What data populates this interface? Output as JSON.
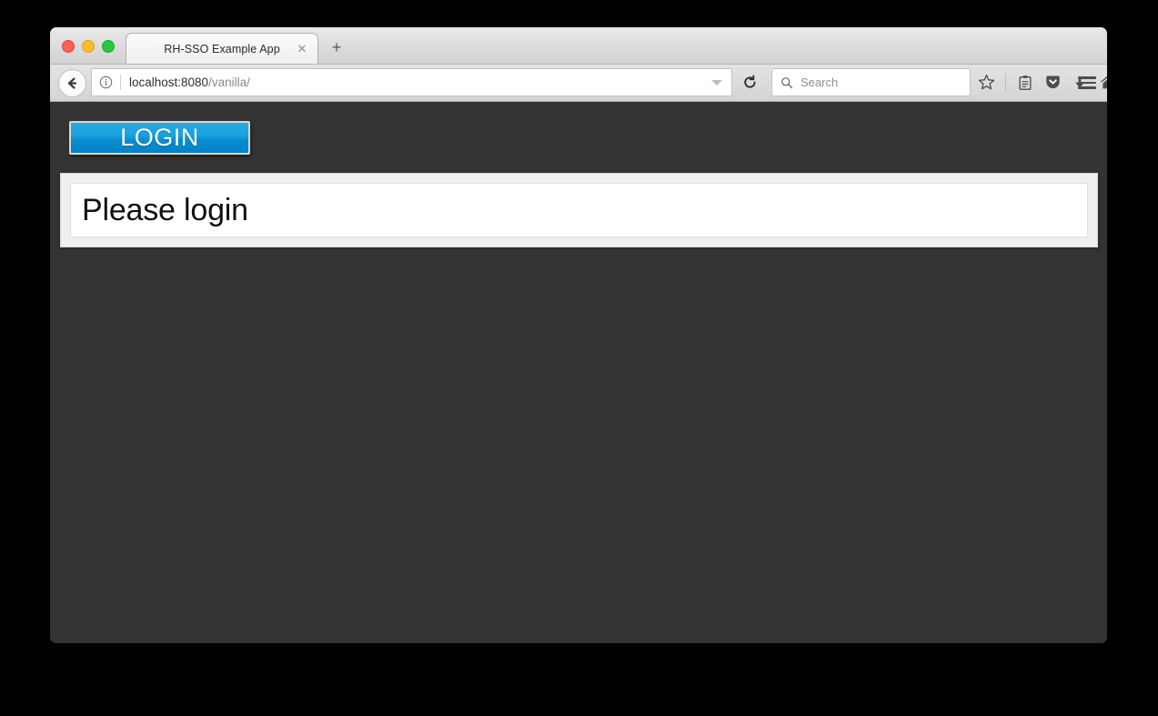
{
  "browser": {
    "window_controls": [
      {
        "name": "close",
        "color": "#ff5f57"
      },
      {
        "name": "minimize",
        "color": "#ffbd2e"
      },
      {
        "name": "zoom",
        "color": "#28c840"
      }
    ],
    "tab": {
      "title": "RH-SSO Example App",
      "close_label": "✕"
    },
    "new_tab_label": "+",
    "address_bar": {
      "host": "localhost:8080",
      "path": "/vanilla/",
      "full_url": "localhost:8080/vanilla/",
      "info_icon": "info-icon",
      "dropdown_icon": "chevron-down-icon"
    },
    "back_icon": "back-arrow-icon",
    "reload_icon": "reload-icon",
    "search": {
      "placeholder": "Search",
      "icon": "search-icon"
    },
    "toolbar_icons": [
      {
        "name": "bookmark-star-icon",
        "glyph": "☆"
      },
      {
        "name": "reader-list-icon",
        "glyph": "Ὄb"
      },
      {
        "name": "pocket-icon",
        "glyph": "shield"
      },
      {
        "name": "download-icon",
        "glyph": "↓"
      },
      {
        "name": "home-icon",
        "glyph": "⌂"
      }
    ],
    "menu_icon": "hamburger-menu-icon"
  },
  "page": {
    "background_color": "#333333",
    "login_button": {
      "label": "LOGIN",
      "accent_color": "#0a8ed0",
      "border_color": "#dcd8d0"
    },
    "panel": {
      "message": "Please login",
      "panel_color": "#efefef",
      "inner_color": "#ffffff"
    }
  }
}
